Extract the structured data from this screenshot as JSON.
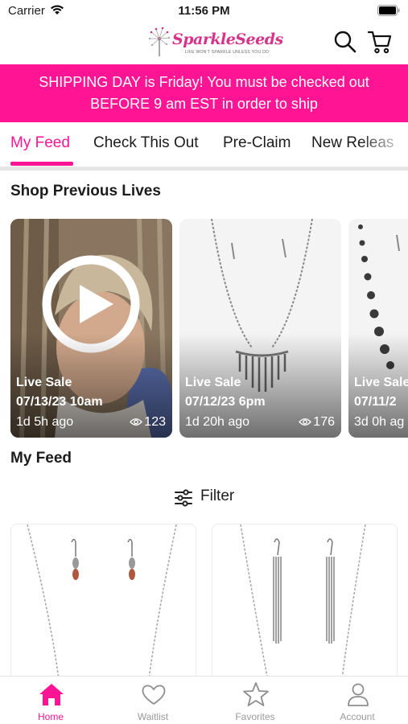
{
  "status_bar": {
    "carrier": "Carrier",
    "time": "11:56 PM"
  },
  "header": {
    "logo_text": "SparkleSeeds",
    "logo_tagline": "LIFE WON'T SPARKLE UNLESS YOU DO"
  },
  "banner": {
    "line1": "SHIPPING DAY is Friday!  You must be checked out",
    "line2": "BEFORE 9 am EST in order to ship"
  },
  "tabs": [
    {
      "label": "My Feed",
      "active": true
    },
    {
      "label": "Check This Out",
      "active": false
    },
    {
      "label": "Pre-Claim",
      "active": false
    },
    {
      "label": "New Releas",
      "active": false
    }
  ],
  "previous_lives": {
    "title": "Shop Previous Lives",
    "items": [
      {
        "label": "Live Sale",
        "date": "07/13/23 10am",
        "ago": "1d 5h ago",
        "views": "123"
      },
      {
        "label": "Live Sale",
        "date": "07/12/23 6pm",
        "ago": "1d 20h ago",
        "views": "176"
      },
      {
        "label": "Live Sale",
        "date": "07/11/2",
        "ago": "3d 0h ag",
        "views": ""
      }
    ]
  },
  "feed": {
    "title": "My Feed",
    "filter_label": "Filter"
  },
  "tabbar": [
    {
      "label": "Home",
      "icon": "home-icon",
      "active": true
    },
    {
      "label": "Waitlist",
      "icon": "heart-icon",
      "active": false
    },
    {
      "label": "Favorites",
      "icon": "star-icon",
      "active": false
    },
    {
      "label": "Account",
      "icon": "person-icon",
      "active": false
    }
  ],
  "colors": {
    "accent": "#ff1493",
    "inactive": "#9a9a9a"
  }
}
